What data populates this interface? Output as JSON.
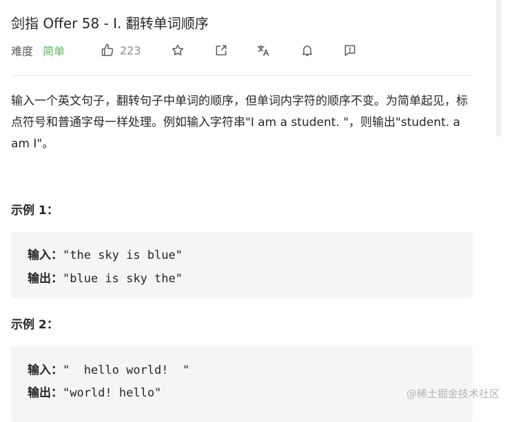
{
  "problem": {
    "title": "剑指 Offer 58 - I. 翻转单词顺序",
    "difficulty_label": "难度",
    "difficulty": "简单",
    "likes": "223"
  },
  "colors": {
    "difficulty_easy": "#5cb85c",
    "code_bg": "#f4f5f6"
  },
  "toolbar": {
    "icons": [
      "thumbs-up-icon",
      "star-icon",
      "share-icon",
      "translate-icon",
      "bell-icon",
      "feedback-icon"
    ]
  },
  "description": "输入一个英文句子，翻转句子中单词的顺序，但单词内字符的顺序不变。为简单起见，标点符号和普通字母一样处理。例如输入字符串\"I am a student. \"，则输出\"student. a am I\"。",
  "examples": [
    {
      "heading": "示例 1：",
      "input_label": "输入：",
      "input_value": "\"the sky is blue\"",
      "output_label": "输出：",
      "output_value": "\"blue is sky the\""
    },
    {
      "heading": "示例 2：",
      "input_label": "输入：",
      "input_value": "\"  hello world!  \"",
      "output_label": "输出：",
      "output_value": "\"world! hello\""
    }
  ],
  "watermark": "@稀土掘金技术社区"
}
